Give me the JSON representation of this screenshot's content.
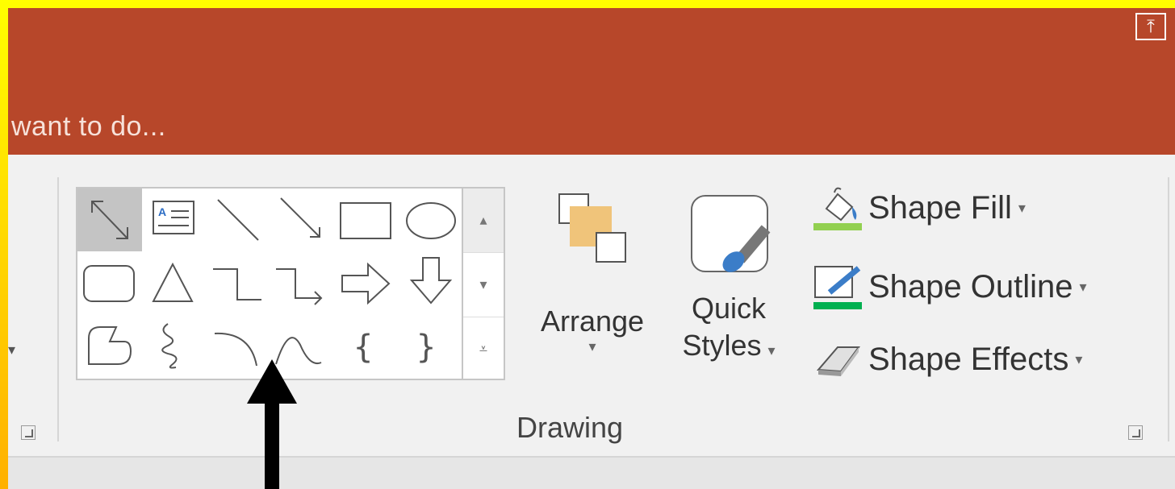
{
  "title_bar": {
    "tell_me_text": "want to do...",
    "collapse_icon": "pin-up-icon",
    "background_color": "#b7472a"
  },
  "ribbon": {
    "insert_shapes_gallery": {
      "shapes": [
        "double-arrow-line-icon",
        "text-box-icon",
        "line-icon",
        "arrow-line-icon",
        "rectangle-icon",
        "oval-icon",
        "rounded-rectangle-icon",
        "triangle-icon",
        "elbow-connector-icon",
        "elbow-arrow-connector-icon",
        "right-arrow-icon",
        "down-arrow-icon",
        "freeform-icon",
        "scribble-icon",
        "arc-icon",
        "curve-icon",
        "left-brace-icon",
        "right-brace-icon"
      ],
      "selected_index": 0
    },
    "arrange": {
      "label": "Arrange",
      "caret": "▾"
    },
    "quick_styles": {
      "label_line1": "Quick",
      "label_line2": "Styles",
      "caret": "▾"
    },
    "shape_fill": {
      "label": "Shape Fill",
      "caret": "▾",
      "color": "#92d050"
    },
    "shape_outline": {
      "label": "Shape Outline",
      "caret": "▾",
      "color": "#00b050"
    },
    "shape_effects": {
      "label": "Shape Effects",
      "caret": "▾"
    },
    "group_label": "Drawing"
  },
  "annotation": {
    "arrow_color": "#000000"
  }
}
